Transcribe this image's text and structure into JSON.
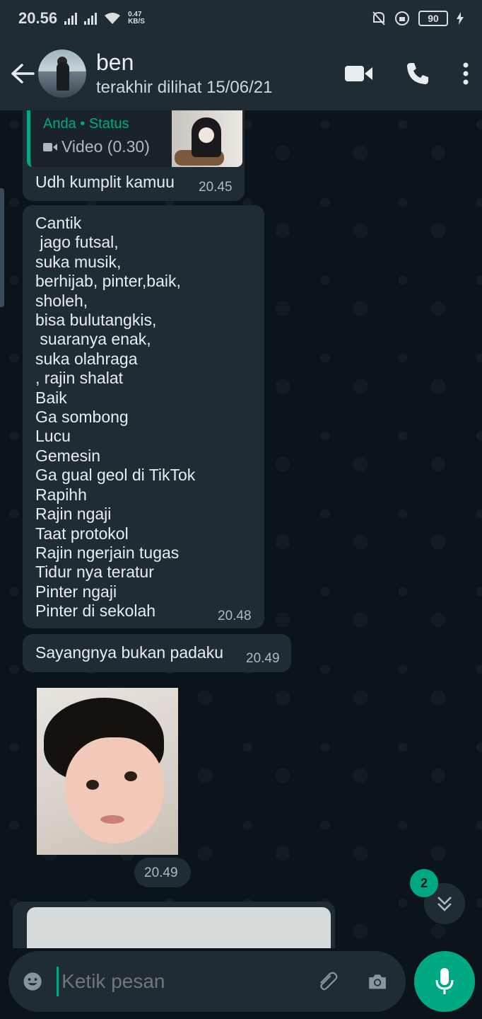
{
  "status_bar": {
    "time": "20.56",
    "speed_value": "0.47",
    "speed_unit": "KB/S",
    "battery": "90"
  },
  "header": {
    "contact_name": "ben",
    "last_seen": "terakhir dilihat 15/06/21",
    "icons": [
      "back-arrow-icon",
      "video-call-icon",
      "phone-icon",
      "more-vert-icon"
    ]
  },
  "messages": {
    "reply": {
      "quote_sender": "Anda • Status",
      "quote_type": "Video (0.30)",
      "text": "Udh kumplit kamuu",
      "time": "20.45"
    },
    "list_message": {
      "lines": [
        "Cantik",
        " jago futsal,",
        "suka musik,",
        "berhijab, pinter,baik,",
        "sholeh,",
        "bisa bulutangkis,",
        " suaranya enak,",
        "suka olahraga",
        ", rajin shalat",
        "Baik",
        "Ga sombong",
        "Lucu",
        "Gemesin",
        "Ga gual geol di TikTok",
        "Rapihh",
        "Rajin ngaji",
        "Taat protokol",
        "Rajin ngerjain tugas",
        "Tidur nya teratur",
        "Pinter ngaji",
        "Pinter di sekolah"
      ],
      "time": "20.48"
    },
    "short_message": {
      "text": "Sayangnya bukan padaku",
      "time": "20.49"
    },
    "sticker": {
      "time": "20.49"
    }
  },
  "scroll_down": {
    "unread_count": "2"
  },
  "composer": {
    "placeholder": "Ketik pesan"
  },
  "colors": {
    "accent": "#00a884",
    "bubble": "#1f2c34",
    "background": "#0b141a"
  }
}
